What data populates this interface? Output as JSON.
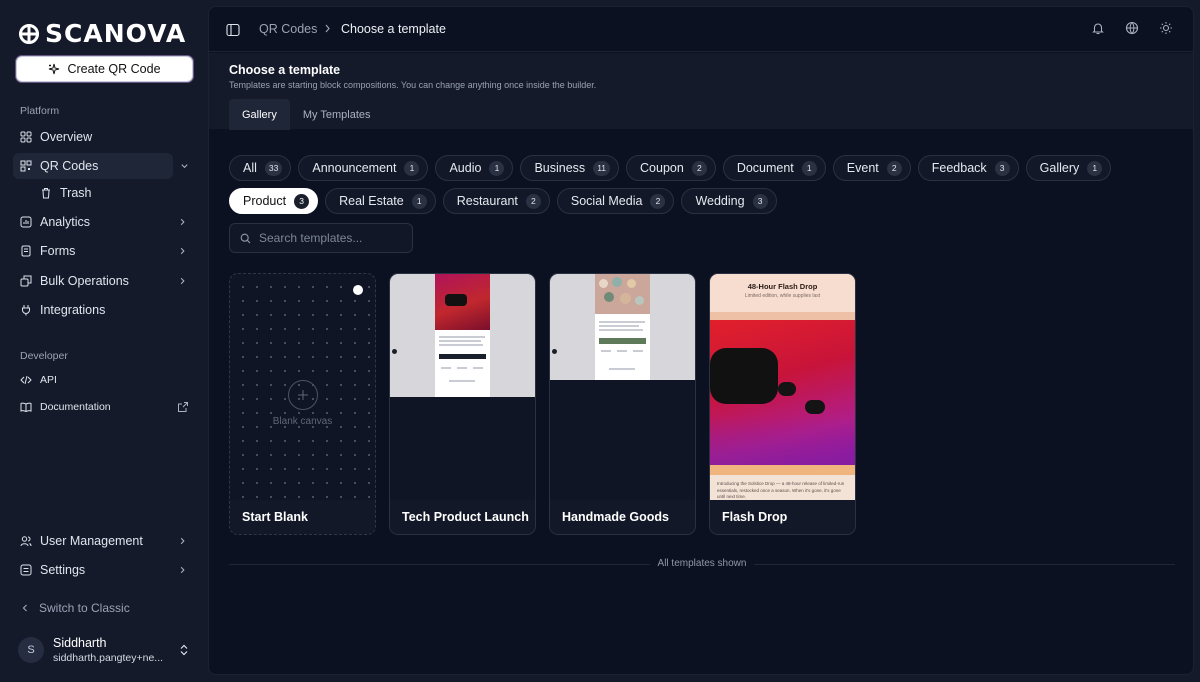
{
  "brand": {
    "logo_text": "SCANOVA"
  },
  "sidebar": {
    "create_label": "Create QR Code",
    "platform_label": "Platform",
    "developer_label": "Developer",
    "items": {
      "overview": "Overview",
      "qr_codes": "QR Codes",
      "trash": "Trash",
      "analytics": "Analytics",
      "forms": "Forms",
      "bulk": "Bulk Operations",
      "integrations": "Integrations",
      "api": "API",
      "docs": "Documentation",
      "user_mgmt": "User Management",
      "settings": "Settings"
    },
    "switch_classic": "Switch to Classic",
    "user": {
      "initial": "S",
      "name": "Siddharth",
      "email": "siddharth.pangtey+ne..."
    }
  },
  "topbar": {
    "breadcrumb": [
      "QR Codes",
      "Choose a template"
    ],
    "icons": [
      "bell-icon",
      "globe-icon",
      "sun-icon"
    ]
  },
  "header": {
    "title": "Choose a template",
    "subtitle": "Templates are starting block compositions. You can change anything once inside the builder.",
    "tabs": [
      "Gallery",
      "My Templates"
    ],
    "active_tab": "Gallery"
  },
  "filters": {
    "row1": [
      {
        "label": "All",
        "count": "33"
      },
      {
        "label": "Announcement",
        "count": "1"
      },
      {
        "label": "Audio",
        "count": "1"
      },
      {
        "label": "Business",
        "count": "11"
      },
      {
        "label": "Coupon",
        "count": "2"
      },
      {
        "label": "Document",
        "count": "1"
      },
      {
        "label": "Event",
        "count": "2"
      },
      {
        "label": "Feedback",
        "count": "3"
      },
      {
        "label": "Gallery",
        "count": "1"
      }
    ],
    "row2": [
      {
        "label": "Product",
        "count": "3"
      },
      {
        "label": "Real Estate",
        "count": "1"
      },
      {
        "label": "Restaurant",
        "count": "2"
      },
      {
        "label": "Social Media",
        "count": "2"
      },
      {
        "label": "Wedding",
        "count": "3"
      }
    ],
    "active": "Product"
  },
  "search": {
    "placeholder": "Search templates..."
  },
  "cards": [
    {
      "label": "Start Blank",
      "blank_text": "Blank canvas"
    },
    {
      "label": "Tech Product Launch"
    },
    {
      "label": "Handmade Goods"
    },
    {
      "label": "Flash Drop",
      "thumb_title": "48-Hour Flash Drop",
      "thumb_subtitle": "Limited edition, while supplies last",
      "thumb_text": "Introducing the Solstice Drop — a 48-hour release of limited-run essentials, restocked once a season. When it's gone, it's gone until next time."
    }
  ],
  "footer": {
    "text": "All templates shown"
  },
  "colors": {
    "background": "#141a2a",
    "main": "#0b1120",
    "accent_active_chip": "#ffffff"
  }
}
